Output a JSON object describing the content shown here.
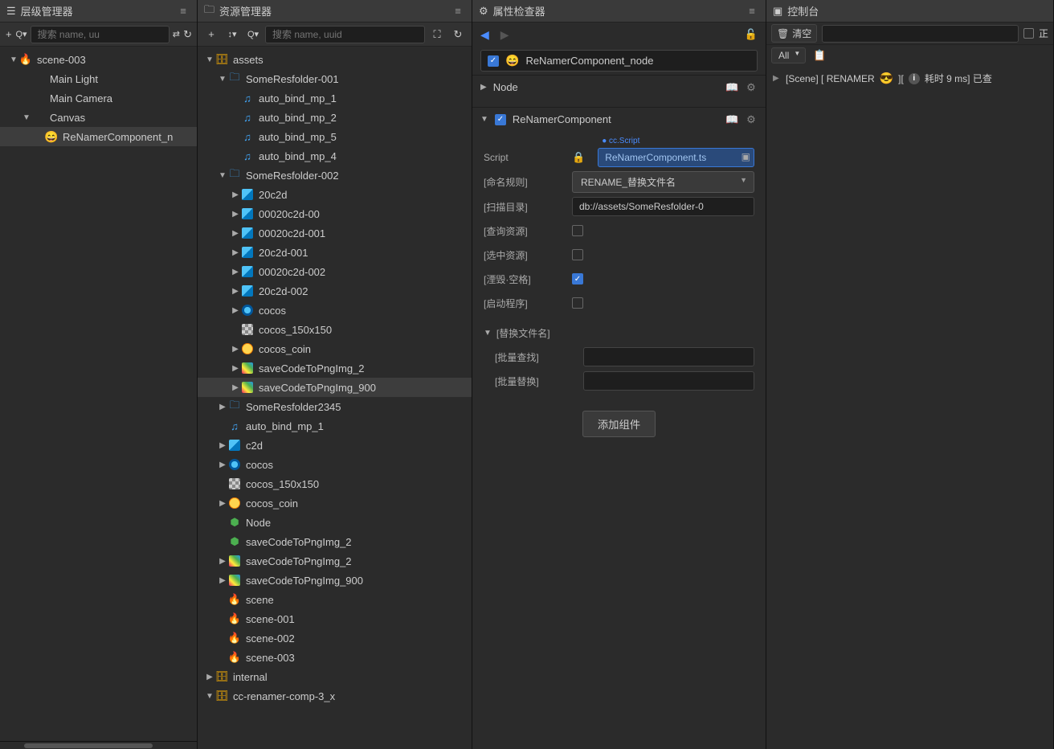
{
  "hierarchy": {
    "title": "层级管理器",
    "search_placeholder": "搜索 name, uu",
    "tree": [
      {
        "depth": 0,
        "arrow": "down",
        "icon": "scene",
        "label": "scene-003"
      },
      {
        "depth": 1,
        "arrow": "none",
        "icon": "",
        "label": "Main Light"
      },
      {
        "depth": 1,
        "arrow": "none",
        "icon": "",
        "label": "Main Camera"
      },
      {
        "depth": 1,
        "arrow": "down",
        "icon": "",
        "label": "Canvas"
      },
      {
        "depth": 2,
        "arrow": "none",
        "icon": "emoji",
        "label": "ReNamerComponent_n",
        "selected": true
      }
    ]
  },
  "assets": {
    "title": "资源管理器",
    "search_placeholder": "搜索 name, uuid",
    "tree": [
      {
        "depth": 0,
        "arrow": "down",
        "icon": "db",
        "label": "assets"
      },
      {
        "depth": 1,
        "arrow": "down",
        "icon": "folder",
        "label": "SomeResfolder-001"
      },
      {
        "depth": 2,
        "arrow": "none",
        "icon": "audio",
        "label": "auto_bind_mp_1"
      },
      {
        "depth": 2,
        "arrow": "none",
        "icon": "audio",
        "label": "auto_bind_mp_2"
      },
      {
        "depth": 2,
        "arrow": "none",
        "icon": "audio",
        "label": "auto_bind_mp_5"
      },
      {
        "depth": 2,
        "arrow": "none",
        "icon": "audio",
        "label": "auto_bind_mp_4"
      },
      {
        "depth": 1,
        "arrow": "down",
        "icon": "folder",
        "label": "SomeResfolder-002"
      },
      {
        "depth": 2,
        "arrow": "right",
        "icon": "image",
        "label": "20c2d"
      },
      {
        "depth": 2,
        "arrow": "right",
        "icon": "image",
        "label": "00020c2d-00"
      },
      {
        "depth": 2,
        "arrow": "right",
        "icon": "image",
        "label": "00020c2d-001"
      },
      {
        "depth": 2,
        "arrow": "right",
        "icon": "image",
        "label": "20c2d-001"
      },
      {
        "depth": 2,
        "arrow": "right",
        "icon": "image",
        "label": "00020c2d-002"
      },
      {
        "depth": 2,
        "arrow": "right",
        "icon": "image",
        "label": "20c2d-002"
      },
      {
        "depth": 2,
        "arrow": "right",
        "icon": "cocos",
        "label": "cocos"
      },
      {
        "depth": 2,
        "arrow": "none",
        "icon": "checker",
        "label": "cocos_150x150"
      },
      {
        "depth": 2,
        "arrow": "right",
        "icon": "coin",
        "label": "cocos_coin"
      },
      {
        "depth": 2,
        "arrow": "right",
        "icon": "png",
        "label": "saveCodeToPngImg_2"
      },
      {
        "depth": 2,
        "arrow": "right",
        "icon": "png",
        "label": "saveCodeToPngImg_900",
        "selected": true
      },
      {
        "depth": 1,
        "arrow": "right",
        "icon": "folder",
        "label": "SomeResfolder2345"
      },
      {
        "depth": 1,
        "arrow": "none",
        "icon": "audio",
        "label": "auto_bind_mp_1"
      },
      {
        "depth": 1,
        "arrow": "right",
        "icon": "image",
        "label": "c2d"
      },
      {
        "depth": 1,
        "arrow": "right",
        "icon": "cocos",
        "label": "cocos"
      },
      {
        "depth": 1,
        "arrow": "none",
        "icon": "checker",
        "label": "cocos_150x150"
      },
      {
        "depth": 1,
        "arrow": "right",
        "icon": "coin",
        "label": "cocos_coin"
      },
      {
        "depth": 1,
        "arrow": "none",
        "icon": "ts",
        "label": "Node"
      },
      {
        "depth": 1,
        "arrow": "none",
        "icon": "ts",
        "label": "saveCodeToPngImg_2"
      },
      {
        "depth": 1,
        "arrow": "right",
        "icon": "png",
        "label": "saveCodeToPngImg_2"
      },
      {
        "depth": 1,
        "arrow": "right",
        "icon": "png",
        "label": "saveCodeToPngImg_900"
      },
      {
        "depth": 1,
        "arrow": "none",
        "icon": "scene",
        "label": "scene"
      },
      {
        "depth": 1,
        "arrow": "none",
        "icon": "scene",
        "label": "scene-001"
      },
      {
        "depth": 1,
        "arrow": "none",
        "icon": "scene",
        "label": "scene-002"
      },
      {
        "depth": 1,
        "arrow": "none",
        "icon": "scene",
        "label": "scene-003"
      },
      {
        "depth": 0,
        "arrow": "right",
        "icon": "db",
        "label": "internal"
      },
      {
        "depth": 0,
        "arrow": "down",
        "icon": "db",
        "label": "cc-renamer-comp-3_x"
      }
    ]
  },
  "inspector": {
    "title": "属性检查器",
    "node_name": "ReNamerComponent_node",
    "node_section": "Node",
    "component": {
      "name": "ReNamerComponent",
      "script_label": "Script",
      "script_badge": "● cc.Script",
      "script_value": "ReNamerComponent.ts",
      "props": {
        "naming_rule_label": "[命名规则]",
        "naming_rule_value": "RENAME_替换文件名",
        "scan_dir_label": "[扫描目录]",
        "scan_dir_value": "db://assets/SomeResfolder-0",
        "query_label": "[查询资源]",
        "select_label": "[选中资源]",
        "destroy_space_label": "[湮毁·空格]",
        "launch_label": "[启动程序]"
      },
      "replace_section": "[替换文件名]",
      "batch_find_label": "[批量查找]",
      "batch_replace_label": "[批量替换]"
    },
    "add_comp_btn": "添加组件"
  },
  "console": {
    "title": "控制台",
    "clear_btn": "清空",
    "filter_all": "All",
    "checkbox_label": "正",
    "log": {
      "prefix": "[Scene] [ RENAMER ",
      "mid": " ][ ",
      "suffix": " 耗时 9 ms] 已查"
    }
  }
}
